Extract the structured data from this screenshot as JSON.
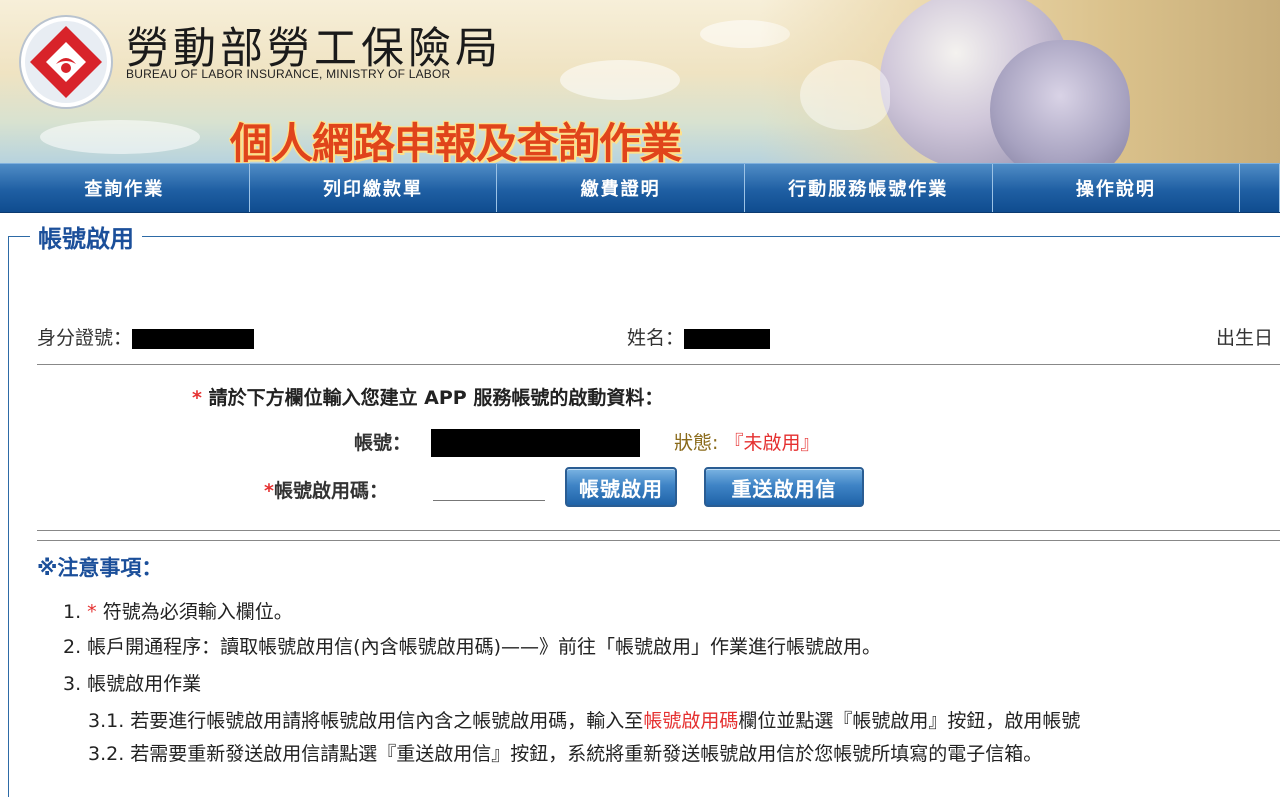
{
  "header": {
    "org_name_cn": "勞動部勞工保險局",
    "org_name_en": "BUREAU OF LABOR INSURANCE, MINISTRY OF LABOR",
    "system_title": "個人網路申報及查詢作業"
  },
  "nav": {
    "items": [
      {
        "label": "查詢作業"
      },
      {
        "label": "列印繳款單"
      },
      {
        "label": "繳費證明"
      },
      {
        "label": "行動服務帳號作業"
      },
      {
        "label": "操作說明"
      }
    ]
  },
  "section": {
    "title": "帳號啟用"
  },
  "identity": {
    "id_label": "身分證號：",
    "name_label": "姓名：",
    "birth_label": "出生日"
  },
  "form": {
    "prompt_star": "*",
    "prompt": "請於下方欄位輸入您建立 APP 服務帳號的啟動資料：",
    "account_label": "帳號：",
    "status_label": "狀態: ",
    "status_value": "『未啟用』",
    "code_star": "*",
    "code_label": "帳號啟用碼：",
    "code_value": "",
    "activate_button": "帳號啟用",
    "resend_button": "重送啟用信"
  },
  "notes": {
    "title": "※注意事項：",
    "n1_prefix": "1. ",
    "n1_star": "*",
    "n1_text": " 符號為必須輸入欄位。",
    "n2": "2. 帳戶開通程序：讀取帳號啟用信(內含帳號啟用碼)——》前往「帳號啟用」作業進行帳號啟用。",
    "n3": "3. 帳號啟用作業",
    "n31_a": "3.1. 若要進行帳號啟用請將帳號啟用信內含之帳號啟用碼，輸入至",
    "n31_hl": "帳號啟用碼",
    "n31_b": "欄位並點選『帳號啟用』按鈕，啟用帳號",
    "n32": "3.2. 若需要重新發送啟用信請點選『重送啟用信』按鈕，系統將重新發送帳號啟用信於您帳號所填寫的電子信箱。"
  }
}
